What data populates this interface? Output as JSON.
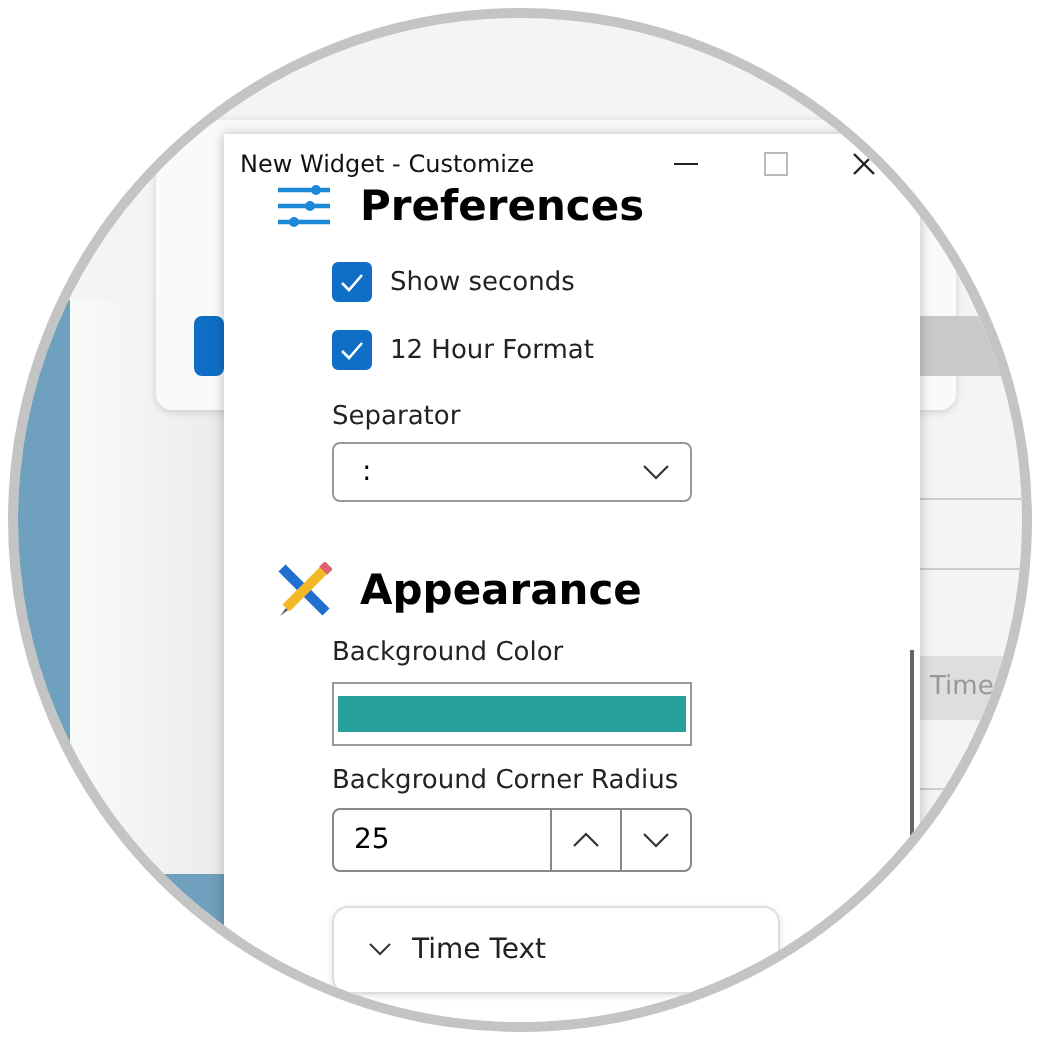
{
  "window": {
    "title": "New Widget - Customize"
  },
  "preferences": {
    "title": "Preferences",
    "options": [
      {
        "label": "Show seconds",
        "checked": true
      },
      {
        "label": "12 Hour Format",
        "checked": true
      }
    ],
    "separator": {
      "label": "Separator",
      "value": ":"
    }
  },
  "appearance": {
    "title": "Appearance",
    "background_color": {
      "label": "Background Color",
      "color": "#27a09d"
    },
    "corner_radius": {
      "label": "Background Corner Radius",
      "value": "25"
    }
  },
  "expander": {
    "label": "Time Text",
    "expanded": false
  },
  "background_window": {
    "button": "Time"
  }
}
